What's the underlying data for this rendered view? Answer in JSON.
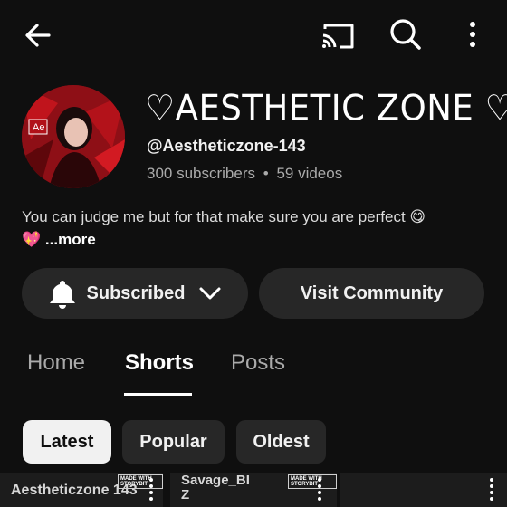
{
  "channel": {
    "name": "♡AESTHETIC ZONE ♡",
    "handle": "@Aestheticzone-143",
    "subscribers": "300 subscribers",
    "videos": "59 videos",
    "separator": "•",
    "description": "You can judge me but for that make sure you are perfect 😋",
    "description_emoji": "💖",
    "more_label": "...more",
    "avatar_text": "Ae"
  },
  "actions": {
    "subscribed_label": "Subscribed",
    "community_label": "Visit Community"
  },
  "tabs": [
    {
      "label": "Home",
      "active": false
    },
    {
      "label": "Shorts",
      "active": true
    },
    {
      "label": "Posts",
      "active": false
    }
  ],
  "filters": [
    {
      "label": "Latest",
      "selected": true
    },
    {
      "label": "Popular",
      "selected": false
    },
    {
      "label": "Oldest",
      "selected": false
    }
  ],
  "shorts": [
    {
      "caption": "Aestheticzone 143",
      "badge": "MADE WITH STORYBIT"
    },
    {
      "caption": "Savage_BI",
      "caption2": "Z",
      "badge": "MADE WITH STORYBIT"
    },
    {
      "caption": "",
      "badge": ""
    }
  ],
  "icons": {
    "back": "arrow-left-icon",
    "cast": "cast-icon",
    "search": "search-icon",
    "more": "more-vertical-icon",
    "bell": "bell-icon",
    "chevron": "chevron-down-icon"
  },
  "colors": {
    "background": "#0f0f0f",
    "button_bg": "#272727",
    "chip_selected_bg": "#f1f1f1",
    "secondary_text": "#aaaaaa",
    "avatar_accent": "#c0141c"
  }
}
